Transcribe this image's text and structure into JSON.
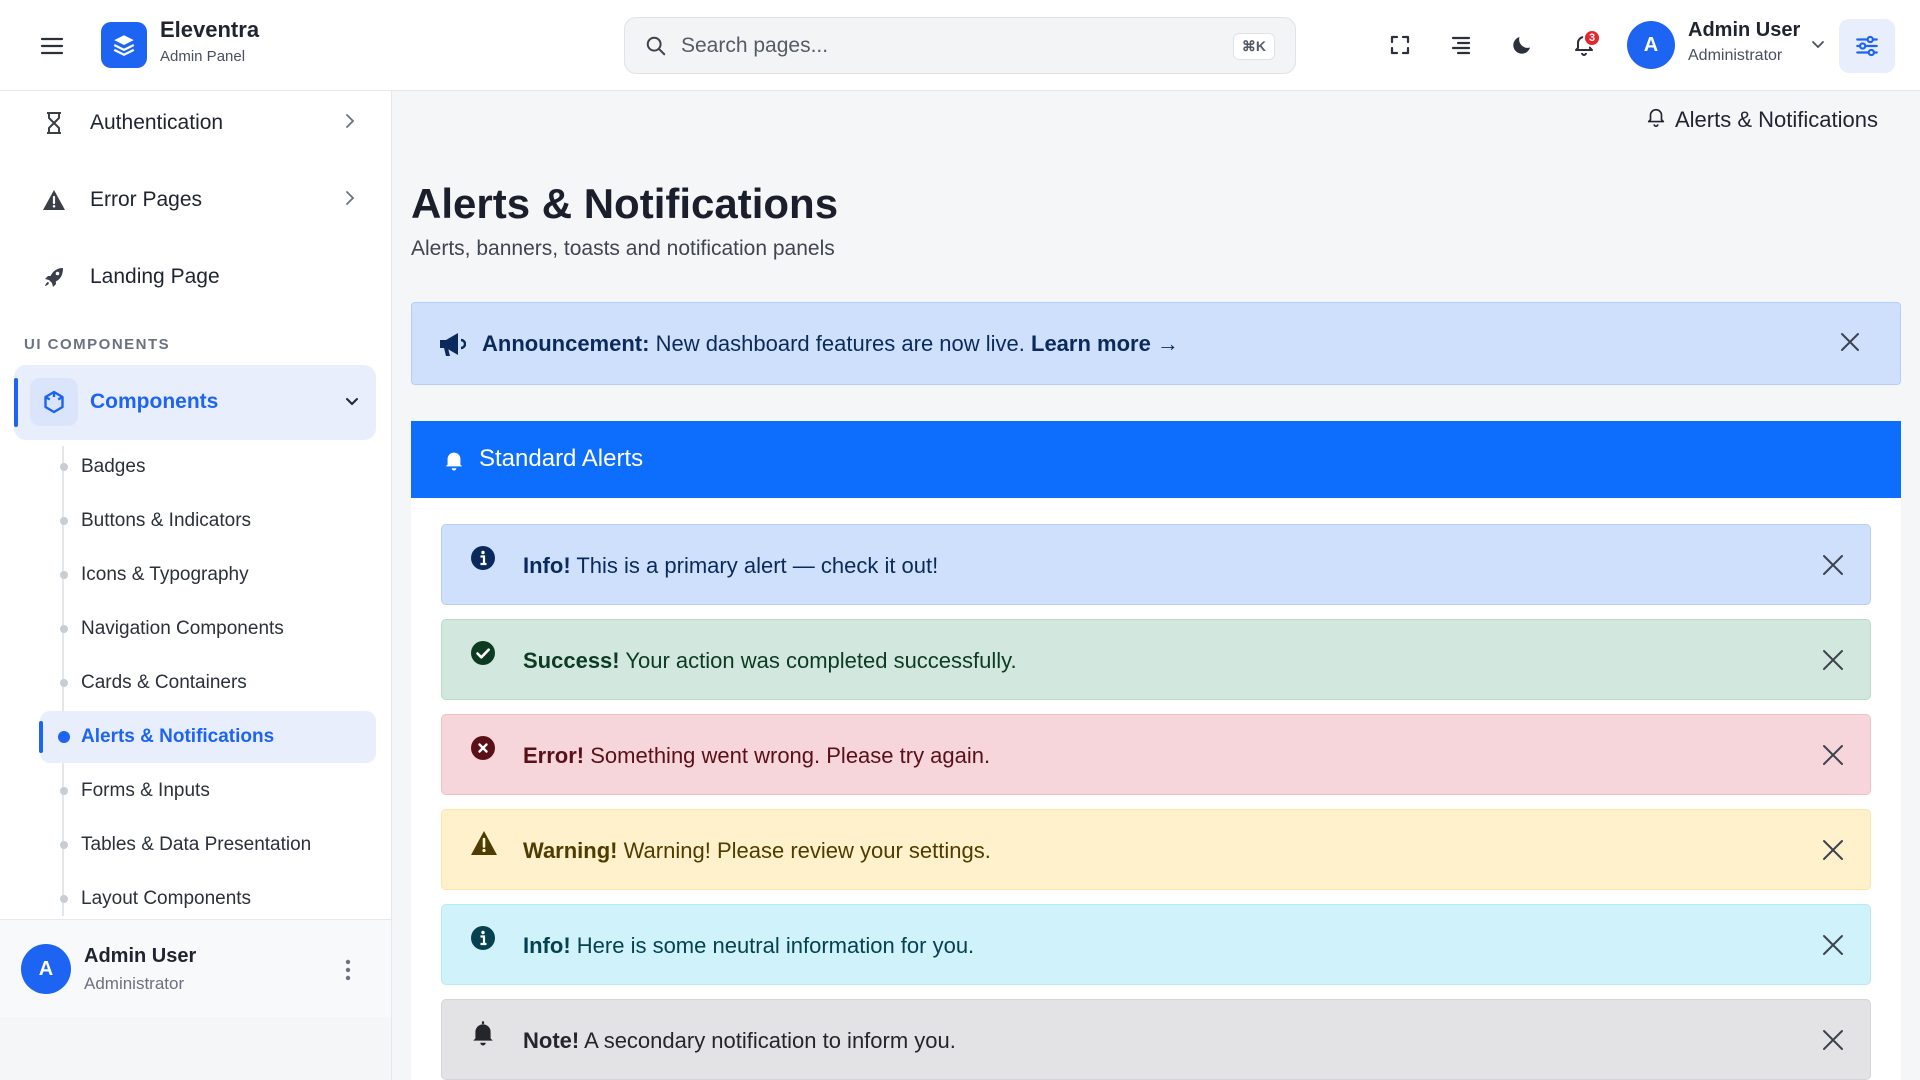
{
  "header": {
    "brand_name": "Eleventra",
    "brand_sub": "Admin Panel",
    "search_placeholder": "Search pages...",
    "search_shortcut": "⌘K",
    "notification_count": "3",
    "user_initial": "A",
    "user_name": "Admin User",
    "user_role": "Administrator"
  },
  "sidebar": {
    "top_items": [
      {
        "label": "Authentication",
        "icon": "hourglass-icon",
        "has_chevron": true
      },
      {
        "label": "Error Pages",
        "icon": "warning-triangle-icon",
        "has_chevron": true
      },
      {
        "label": "Landing Page",
        "icon": "rocket-icon",
        "has_chevron": false
      }
    ],
    "section_title": "UI COMPONENTS",
    "components_label": "Components",
    "sub_items": [
      {
        "label": "Badges",
        "active": false
      },
      {
        "label": "Buttons & Indicators",
        "active": false
      },
      {
        "label": "Icons & Typography",
        "active": false
      },
      {
        "label": "Navigation Components",
        "active": false
      },
      {
        "label": "Cards & Containers",
        "active": false
      },
      {
        "label": "Alerts & Notifications",
        "active": true
      },
      {
        "label": "Forms & Inputs",
        "active": false
      },
      {
        "label": "Tables & Data Presentation",
        "active": false
      },
      {
        "label": "Layout Components",
        "active": false
      }
    ],
    "footer": {
      "initial": "A",
      "name": "Admin User",
      "role": "Administrator"
    }
  },
  "main": {
    "breadcrumb": "Alerts & Notifications",
    "title": "Alerts & Notifications",
    "subtitle": "Alerts, banners, toasts and notification panels",
    "announcement": {
      "label": "Announcement:",
      "text": " New dashboard features are now live. ",
      "link": "Learn more →"
    },
    "card_title": "Standard Alerts",
    "alerts": [
      {
        "label": "Info!",
        "text": " This is a primary alert — check it out!",
        "icon": "info-circle-icon",
        "bg": "#cfe0fd",
        "border": "#b6cff8",
        "fg": "#0a2a5c"
      },
      {
        "label": "Success!",
        "text": " Your action was completed successfully.",
        "icon": "check-circle-icon",
        "bg": "#d2e8df",
        "border": "#b8dccb",
        "fg": "#0c3b22"
      },
      {
        "label": "Error!",
        "text": " Something went wrong. Please try again.",
        "icon": "x-circle-icon",
        "bg": "#f6d5db",
        "border": "#f0c0c8",
        "fg": "#5a1018"
      },
      {
        "label": "Warning!",
        "text": " Warning! Please review your settings.",
        "icon": "warning-triangle-icon",
        "bg": "#fff1cc",
        "border": "#fde6a6",
        "fg": "#4f3c00"
      },
      {
        "label": "Info!",
        "text": " Here is some neutral information for you.",
        "icon": "info-circle-icon",
        "bg": "#cff2fb",
        "border": "#b5eaf7",
        "fg": "#05414f"
      },
      {
        "label": "Note!",
        "text": " A secondary notification to inform you.",
        "icon": "bell-icon",
        "bg": "#e3e3e5",
        "border": "#d4d5d8",
        "fg": "#24262b"
      }
    ]
  }
}
